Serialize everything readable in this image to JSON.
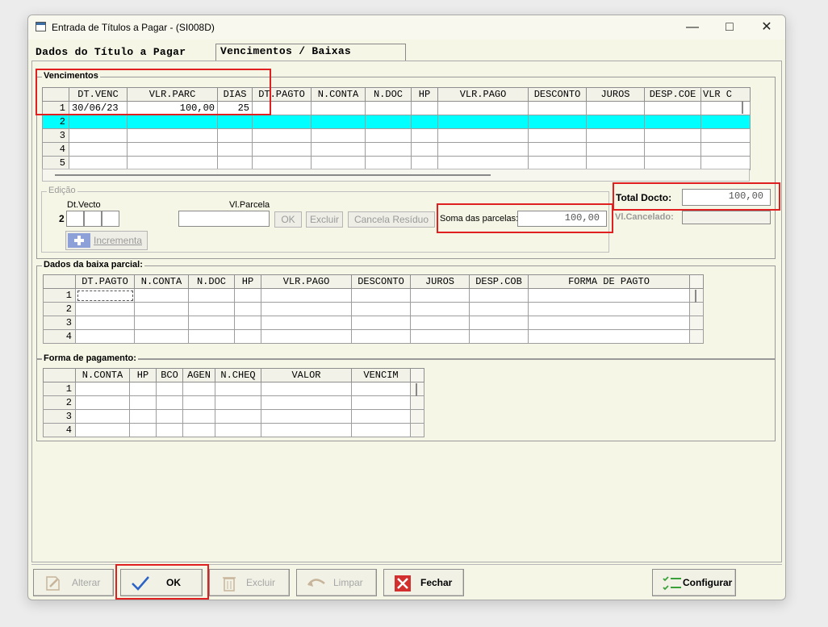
{
  "window": {
    "title": "Entrada de Títulos a Pagar - (SI008D)"
  },
  "tabs": [
    {
      "label": "Dados do Título a Pagar"
    },
    {
      "label": "Vencimentos / Baixas"
    }
  ],
  "vencimentos": {
    "title": "Vencimentos",
    "columns": [
      "DT.VENC",
      "VLR.PARC",
      "DIAS",
      "DT.PAGTO",
      "N.CONTA",
      "N.DOC",
      "HP",
      "VLR.PAGO",
      "DESCONTO",
      "JUROS",
      "DESP.COE",
      "VLR C"
    ],
    "rows": [
      {
        "n": "1",
        "dt_venc": "30/06/23",
        "vlr_parc": "100,00",
        "dias": "25"
      },
      {
        "n": "2",
        "dt_venc": "",
        "vlr_parc": "",
        "dias": ""
      },
      {
        "n": "3",
        "dt_venc": "",
        "vlr_parc": "",
        "dias": ""
      },
      {
        "n": "4",
        "dt_venc": "",
        "vlr_parc": "",
        "dias": ""
      },
      {
        "n": "5",
        "dt_venc": "",
        "vlr_parc": "",
        "dias": ""
      }
    ]
  },
  "edicao": {
    "title": "Edição",
    "dt_vecto_label": "Dt.Vecto",
    "vl_parcela_label": "Vl.Parcela",
    "row_number": "2",
    "ok_label": "OK",
    "excluir_label": "Excluir",
    "cancela_residuo_label": "Cancela Resíduo",
    "soma_label": "Soma das parcelas:",
    "soma_value": "100,00",
    "incrementa_label": "Incrementa"
  },
  "totals": {
    "total_docto_label": "Total Docto:",
    "total_docto_value": "100,00",
    "vl_cancelado_label": "Vl.Cancelado:"
  },
  "baixa_parcial": {
    "title": "Dados da baixa parcial:",
    "columns": [
      "DT.PAGTO",
      "N.CONTA",
      "N.DOC",
      "HP",
      "VLR.PAGO",
      "DESCONTO",
      "JUROS",
      "DESP.COB",
      "FORMA DE PAGTO"
    ],
    "rows": [
      "1",
      "2",
      "3",
      "4"
    ]
  },
  "forma_pagamento": {
    "title": "Forma de pagamento:",
    "columns": [
      "N.CONTA",
      "HP",
      "BCO",
      "AGEN",
      "N.CHEQ",
      "VALOR",
      "VENCIM"
    ],
    "rows": [
      "1",
      "2",
      "3",
      "4"
    ]
  },
  "buttons": {
    "alterar": "Alterar",
    "ok": "OK",
    "excluir": "Excluir",
    "limpar": "Limpar",
    "fechar": "Fechar",
    "configurar": "Configurar"
  },
  "colors": {
    "highlight": "#e02020",
    "selected_row": "#00ffff"
  }
}
